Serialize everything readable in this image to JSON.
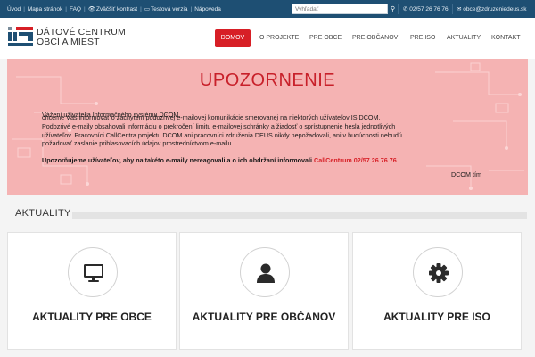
{
  "topbar": {
    "links": [
      "Úvod",
      "Mapa stránok",
      "FAQ",
      "Zväčšiť kontrast",
      "Testová verzia",
      "Nápoveda"
    ],
    "search_placeholder": "Vyhľadať",
    "phone": "02/57 26 76 76",
    "email": "obce@zdruzeniedeus.sk"
  },
  "header": {
    "logo_line1": "DÁTOVÉ CENTRUM",
    "logo_line2": "OBCÍ A MIEST",
    "nav": [
      "DOMOV",
      "O PROJEKTE",
      "PRE OBCE",
      "PRE OBČANOV",
      "PRE ISO",
      "AKTUALITY",
      "KONTAKT"
    ],
    "active_nav": "DOMOV"
  },
  "banner": {
    "title": "UPOZORNENIE",
    "greeting": "Vážení užívatelia Informačného systému DCOM,",
    "p1_line1": "chceme Vás informovať o zachytení podozrivej e-mailovej komunikácie smerovanej na niektorých užívateľov IS DCOM.",
    "p1_line2": "Podozrivé e-maily obsahovali informáciu o prekročení limitu e-mailovej schránky a žiadosť o sprístupnenie hesla jednotlivých",
    "p1_line3": "užívateľov. Pracovníci CallCentra projektu DCOM ani pracovníci združenia DEUS nikdy nepožadovali, ani v budúcnosti nebudú",
    "p1_line4": "požadovať zaslanie prihlasovacích údajov prostredníctvom e-mailu.",
    "warning": "Upozorňujeme užívateľov, aby na takéto e-maily nereagovali a o ich obdržaní informovali",
    "callcentrum": "CallCentrum 02/57 26 76 76",
    "signature": "DCOM tím"
  },
  "section": {
    "title": "AKTUALITY"
  },
  "cards": [
    {
      "title": "AKTUALITY PRE OBCE",
      "icon": "monitor-icon"
    },
    {
      "title": "AKTUALITY PRE OBČANOV",
      "icon": "user-icon"
    },
    {
      "title": "AKTUALITY PRE ISO",
      "icon": "gear-icon"
    }
  ],
  "colors": {
    "topbar": "#1e4f73",
    "brand_red": "#d71f26",
    "banner_bg": "#f5b3b3"
  }
}
